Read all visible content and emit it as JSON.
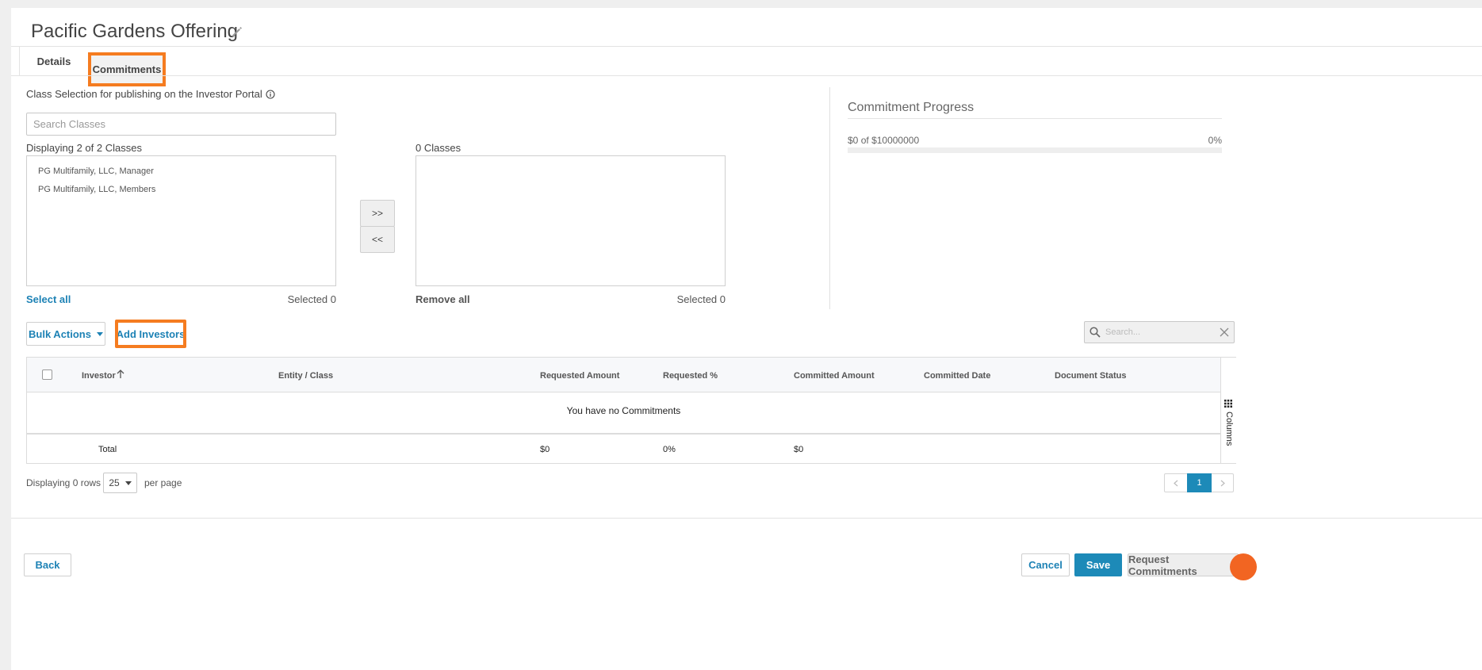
{
  "page": {
    "title": "Pacific Gardens Offering"
  },
  "tabs": [
    {
      "label": "Details"
    },
    {
      "label": "Commitments"
    }
  ],
  "class_selection": {
    "heading": "Class Selection for publishing on the Investor Portal",
    "search_placeholder": "Search Classes",
    "available_caption": "Displaying 2 of 2 Classes",
    "available_items": [
      "PG Multifamily, LLC, Manager",
      "PG Multifamily, LLC, Members"
    ],
    "selected_caption": "0 Classes",
    "move_right": ">>",
    "move_left": "<<",
    "select_all": "Select all",
    "remove_all": "Remove all",
    "left_selected": "Selected 0",
    "right_selected": "Selected 0"
  },
  "progress": {
    "title": "Commitment Progress",
    "amount_text": "$0",
    "of": "of",
    "goal_text": "$10000000",
    "percent_text": "0%",
    "fraction": 0
  },
  "toolbar": {
    "bulk_actions": "Bulk Actions",
    "add_investors": "Add Investors",
    "search_placeholder": "Search..."
  },
  "table": {
    "columns": [
      "Investor",
      "Entity / Class",
      "Requested Amount",
      "Requested %",
      "Committed Amount",
      "Committed Date",
      "Document Status"
    ],
    "empty_message": "You have no Commitments",
    "total_label": "Total",
    "totals": {
      "requested_amount": "$0",
      "requested_pct": "0%",
      "committed_amount": "$0"
    },
    "columns_panel": "Columns"
  },
  "pagination": {
    "displaying": "Displaying 0 rows",
    "page_size": "25",
    "per_page": "per page",
    "current_page": "1"
  },
  "footer": {
    "back": "Back",
    "cancel": "Cancel",
    "save": "Save",
    "request": "Request Commitments"
  },
  "colors": {
    "accent": "#1d82b5",
    "highlight": "#f57c20",
    "save": "#1d8ab8",
    "help": "#f26522"
  }
}
